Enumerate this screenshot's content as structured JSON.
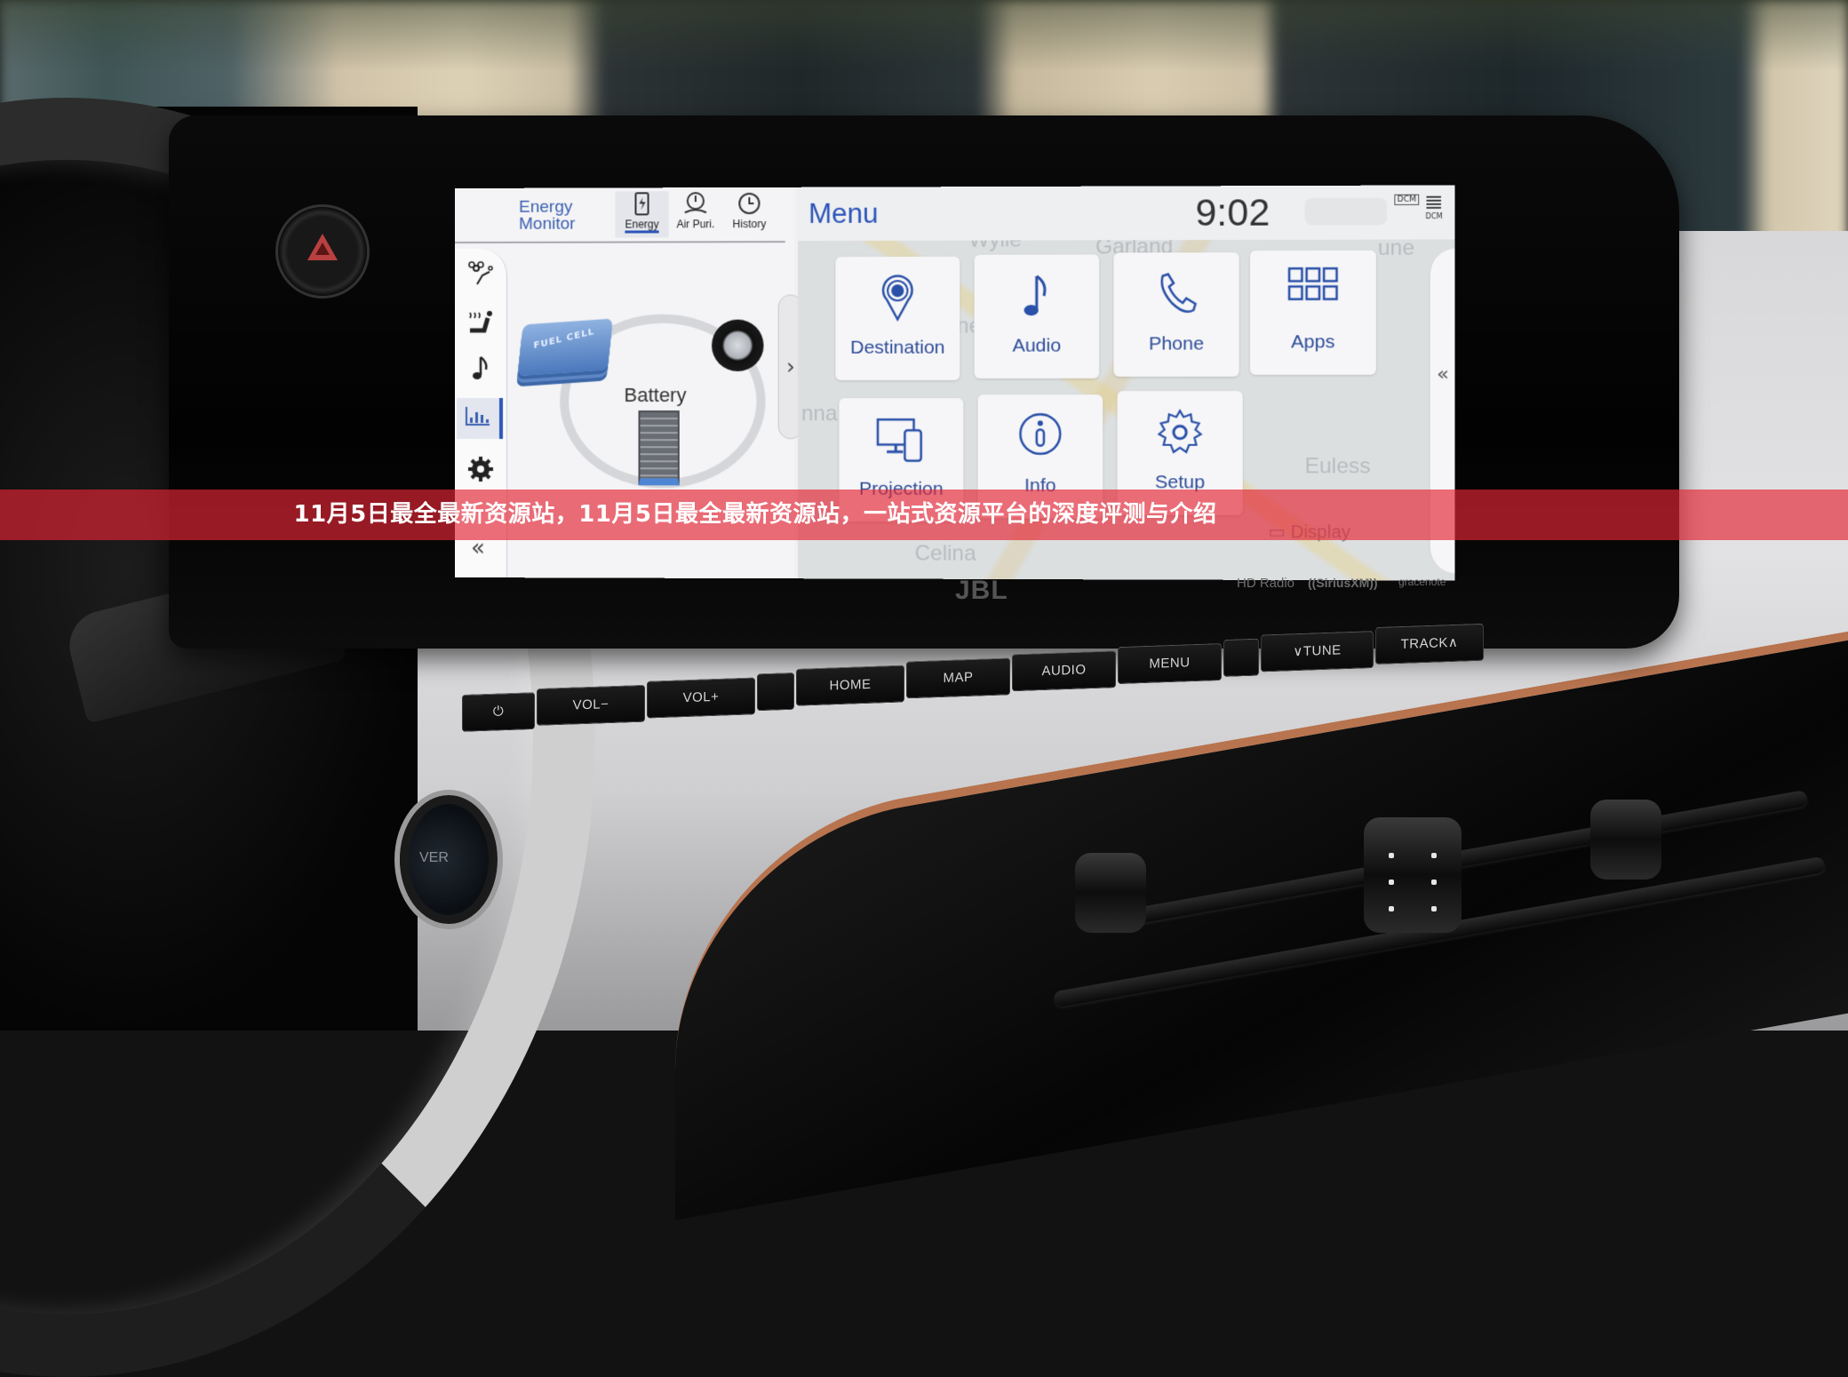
{
  "banner": {
    "caption": "11月5日最全最新资源站，11月5日最全最新资源站，一站式资源平台的深度评测与介绍",
    "color": "#e42434"
  },
  "energy_monitor": {
    "title_line1": "Energy",
    "title_line2": "Monitor",
    "tabs": [
      {
        "label": "Energy",
        "icon": "battery-bolt-icon",
        "active": true
      },
      {
        "label": "Air Puri.",
        "icon": "air-purifier-icon",
        "active": false
      },
      {
        "label": "History",
        "icon": "clock-icon",
        "active": false
      }
    ],
    "side_rail": [
      {
        "icon": "fan-seat-icon",
        "active": false
      },
      {
        "icon": "seat-heater-icon",
        "active": false
      },
      {
        "icon": "music-note-icon",
        "active": false
      },
      {
        "icon": "bar-chart-icon",
        "active": true
      },
      {
        "icon": "gear-icon",
        "active": false
      }
    ],
    "diagram": {
      "fuel_cell_label": "FUEL CELL",
      "battery_label": "Battery"
    },
    "collapse_glyph": "«",
    "expand_glyph": "›"
  },
  "menu": {
    "title": "Menu",
    "time": "9:02",
    "status_dcm": "DCM",
    "status_dcm2": "DCM",
    "tiles": [
      {
        "label": "Destination",
        "icon": "map-pin-icon"
      },
      {
        "label": "Audio",
        "icon": "music-note-icon"
      },
      {
        "label": "Phone",
        "icon": "phone-icon"
      },
      {
        "label": "Apps",
        "icon": "apps-grid-icon"
      },
      {
        "label": "Projection",
        "icon": "projection-icon"
      },
      {
        "label": "Info",
        "icon": "info-icon"
      },
      {
        "label": "Setup",
        "icon": "gear-icon"
      }
    ],
    "display_label": "Display",
    "edge_glyph": "«",
    "map_labels": [
      "Wylie",
      "Garland",
      "McKinney",
      "Euless",
      "Celina",
      "nna",
      "une"
    ]
  },
  "hardkeys": [
    {
      "label": "⏻",
      "name": "power"
    },
    {
      "label": "VOL−",
      "name": "vol-down"
    },
    {
      "label": "VOL+",
      "name": "vol-up"
    },
    {
      "label": "",
      "name": "blank-1"
    },
    {
      "label": "HOME",
      "name": "home"
    },
    {
      "label": "MAP",
      "name": "map"
    },
    {
      "label": "AUDIO",
      "name": "audio"
    },
    {
      "label": "MENU",
      "name": "menu"
    },
    {
      "label": "",
      "name": "blank-2"
    },
    {
      "label": "∨TUNE",
      "name": "tune"
    },
    {
      "label": "TRACK∧",
      "name": "track"
    }
  ],
  "brands": {
    "speaker": "JBL",
    "hd_radio": "HD Radio",
    "siriusxm": "((SiriusXM))",
    "gracenote": "gracenote"
  },
  "power_button_text": "VER"
}
